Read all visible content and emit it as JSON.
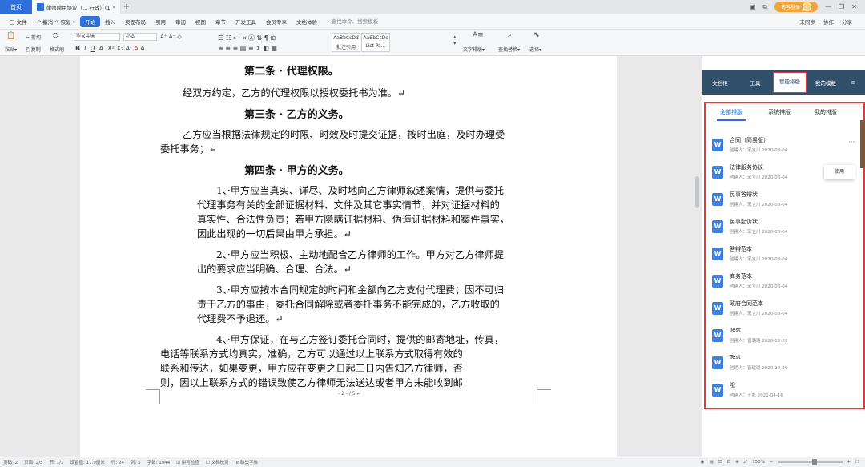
{
  "titlebar": {
    "home_tab": "首页",
    "doc_tab": "律师聘用协议（... 行政）(1)",
    "login": "访客登录",
    "icons": [
      "layout-icon",
      "minimize-icon",
      "restore-icon",
      "close-icon"
    ]
  },
  "menubar": {
    "file": "三 文件",
    "undo_redo": "↶ 撤消 ↷ 恢复 ▾",
    "items": [
      "开始",
      "插入",
      "页面布局",
      "引用",
      "审阅",
      "视图",
      "章节",
      "开发工具",
      "会员专享",
      "文档体验"
    ],
    "search": "查找命令、搜索模板",
    "right": [
      "未同步",
      "协作",
      "分享"
    ]
  },
  "ribbon": {
    "paste": "粘贴▾",
    "cut": "剪切",
    "copy": "复制",
    "format_painter": "格式刷",
    "font_name": "华文中宋",
    "font_size": "小四",
    "style1_preview": "AaBbCcDd",
    "style1_name": "批注引用",
    "style2_preview": "AaBbCcDc",
    "style2_name": "List Pa...",
    "text_layout": "文字排版▾",
    "find_replace": "查找替换▾",
    "select": "选择▾"
  },
  "document": {
    "h2": "第二条 · 代理权限。",
    "p2": "经双方约定，乙方的代理权限以授权委托书为准。↵",
    "h3": "第三条 · 乙方的义务。",
    "p3_line1": "乙方应当根据法律规定的时限、时效及时提交证据，按时出庭，及时办理受",
    "p3_line2": "委托事务；↵",
    "h4": "第四条 · 甲方的义务。",
    "p4_1_lines": [
      "1、·甲方应当真实、详尽、及时地向乙方律师叙述案情，提供与委托",
      "代理事务有关的全部证据材料、文件及其它事实情节，并对证据材料的",
      "真实性、合法性负责；若甲方隐瞒证据材料、伪造证据材料和案件事实，",
      "因此出现的一切后果由甲方承担。↵"
    ],
    "p4_2_lines": [
      "2、·甲方应当积极、主动地配合乙方律师的工作。甲方对乙方律师提",
      "出的要求应当明确、合理、合法。↵"
    ],
    "p4_3_lines": [
      "3、·甲方应按本合同规定的时间和金额向乙方支付代理费；因不可归",
      "责于乙方的事由，委托合同解除或者委托事务不能完成的，乙方收取的",
      "代理费不予退还。↵"
    ],
    "p4_4_lines": [
      "4、·甲方保证，在与乙方签订委托合同时，提供的邮寄地址，传真，",
      "电话等联系方式均真实，准确，乙方可以通过以上联系方式取得有效的",
      "联系和传达，如果变更，甲方应在变更之日起三日内告知乙方律师，否",
      "则，因以上联系方式的错误致使乙方律师无法送达或者甲方未能收到邮"
    ],
    "page_number": "- 2 - / 5 ↵"
  },
  "panel": {
    "tabs": [
      "文档柜",
      "工具",
      "智能排版",
      "我的模版"
    ],
    "menu_icon": "≡",
    "subtabs": [
      "全部排版",
      "系统排版",
      "我的排版"
    ],
    "items": [
      {
        "name": "合同（简易版）",
        "meta": "创建人：宋立川 2020-08-04"
      },
      {
        "name": "法律服务协议",
        "meta": "创建人：宋立川 2020-08-04"
      },
      {
        "name": "民事答辩状",
        "meta": "创建人：宋立川 2020-08-04"
      },
      {
        "name": "民事起诉状",
        "meta": "创建人：宋立川 2020-08-04"
      },
      {
        "name": "答辩范本",
        "meta": "创建人：宋立川 2020-08-04"
      },
      {
        "name": "商务范本",
        "meta": "创建人：宋立川 2020-08-04"
      },
      {
        "name": "政府合同范本",
        "meta": "创建人：宋立川 2020-08-04"
      },
      {
        "name": "Test",
        "meta": "创建人：曾璐璐 2020-12-29"
      },
      {
        "name": "Test",
        "meta": "创建人：曾璐璐 2020-12-29"
      },
      {
        "name": "哦",
        "meta": "创建人：王凯 2021-04-16"
      }
    ],
    "popup": "使用",
    "more": "···"
  },
  "statusbar": {
    "items": [
      "页码: 2",
      "页面: 2/5",
      "节: 1/1",
      "设置值: 17.9厘米",
      "行: 24",
      "列: 5",
      "字数: 1944",
      "☑ 拼写检查",
      "☐ 文档校对",
      "Tr 缺失字体"
    ],
    "zoom": "150%"
  }
}
